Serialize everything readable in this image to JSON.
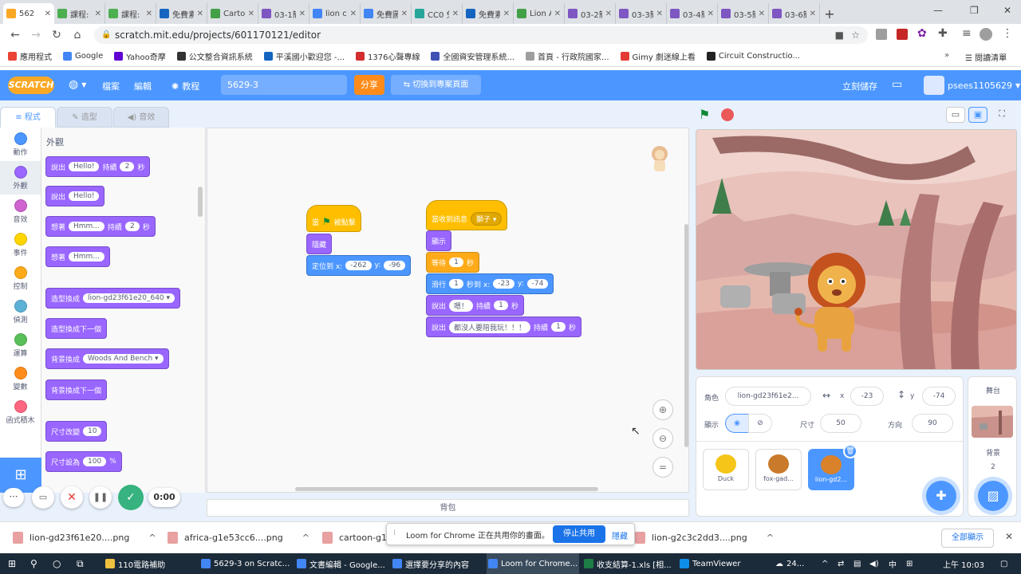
{
  "browser": {
    "tabs": [
      {
        "label": "562",
        "color": "#f9a825",
        "active": true
      },
      {
        "label": "課程:",
        "color": "#4caf50"
      },
      {
        "label": "課程:",
        "color": "#4caf50"
      },
      {
        "label": "免費素",
        "color": "#1565c0"
      },
      {
        "label": "Carto",
        "color": "#43a047"
      },
      {
        "label": "03-1簡",
        "color": "#7e57c2"
      },
      {
        "label": "lion ca",
        "color": "#4285f4"
      },
      {
        "label": "免費圖",
        "color": "#4285f4"
      },
      {
        "label": "CC0 免",
        "color": "#26a69a"
      },
      {
        "label": "免費素",
        "color": "#1565c0"
      },
      {
        "label": "Lion A",
        "color": "#43a047"
      },
      {
        "label": "03-2簡",
        "color": "#7e57c2"
      },
      {
        "label": "03-3簡",
        "color": "#7e57c2"
      },
      {
        "label": "03-4簡",
        "color": "#7e57c2"
      },
      {
        "label": "03-5簡",
        "color": "#7e57c2"
      },
      {
        "label": "03-6簡",
        "color": "#7e57c2"
      }
    ],
    "url": "scratch.mit.edu/projects/601170121/editor",
    "bookmarks": [
      {
        "label": "應用程式",
        "color": "#ea4335"
      },
      {
        "label": "Google",
        "color": "#4285f4"
      },
      {
        "label": "Yahoo奇摩",
        "color": "#6001d2"
      },
      {
        "label": "公文整合資訊系統",
        "color": "#333333"
      },
      {
        "label": "平溪國小歡迎您 -...",
        "color": "#1565c0"
      },
      {
        "label": "1376心聲專線",
        "color": "#d32f2f"
      },
      {
        "label": "全國資安管理系統...",
        "color": "#3f51b5"
      },
      {
        "label": "首頁 - 行政院國家...",
        "color": "#9e9e9e"
      },
      {
        "label": "Gimy 劇迷線上看",
        "color": "#e53935"
      },
      {
        "label": "Circuit Constructio...",
        "color": "#222222"
      }
    ],
    "reading_list": "閱讀清單"
  },
  "scratch": {
    "logo": "SCRATCH",
    "menu_file": "檔案",
    "menu_edit": "編輯",
    "tutorials": "教程",
    "project_title": "5629-3",
    "share": "分享",
    "see_project": "切換到專案頁面",
    "save_now": "立刻儲存",
    "username": "psees1105629",
    "tab_code": "程式",
    "tab_costumes": "造型",
    "tab_sounds": "音效",
    "categories": [
      {
        "label": "動作",
        "color": "#4c97ff"
      },
      {
        "label": "外觀",
        "color": "#9966ff",
        "active": true
      },
      {
        "label": "音效",
        "color": "#cf63cf"
      },
      {
        "label": "事件",
        "color": "#ffd500"
      },
      {
        "label": "控制",
        "color": "#ffab19"
      },
      {
        "label": "偵測",
        "color": "#5cb1d6"
      },
      {
        "label": "運算",
        "color": "#59c059"
      },
      {
        "label": "變數",
        "color": "#ff8c1a"
      },
      {
        "label": "函式積木",
        "color": "#ff6680"
      }
    ],
    "palette_title": "外觀",
    "palette": {
      "say_for": {
        "a": "說出",
        "v1": "Hello!",
        "b": "持續",
        "v2": "2",
        "c": "秒"
      },
      "say": {
        "a": "說出",
        "v1": "Hello!"
      },
      "think_for": {
        "a": "想著",
        "v1": "Hmm...",
        "b": "持續",
        "v2": "2",
        "c": "秒"
      },
      "think": {
        "a": "想著",
        "v1": "Hmm..."
      },
      "switch_costume": {
        "a": "造型換成",
        "v1": "lion-gd23f61e20_640"
      },
      "next_costume": "造型換成下一個",
      "switch_backdrop": {
        "a": "背景換成",
        "v1": "Woods And Bench"
      },
      "next_backdrop": "背景換成下一個",
      "change_size": {
        "a": "尺寸改變",
        "v1": "10"
      },
      "set_size": {
        "a": "尺寸設為",
        "v1": "100",
        "b": "%"
      }
    },
    "script1": {
      "hat_a": "當",
      "hat_b": "被點擊",
      "hide": "隱藏",
      "goto": {
        "a": "定位到 x:",
        "x": "-262",
        "b": "y:",
        "y": "-96"
      }
    },
    "script2": {
      "hat_a": "當收到訊息",
      "hat_v": "獅子",
      "show": "顯示",
      "wait": {
        "a": "等待",
        "v": "1",
        "b": "秒"
      },
      "glide": {
        "a": "滑行",
        "v": "1",
        "b": "秒到 x:",
        "x": "-23",
        "c": "y:",
        "y": "-74"
      },
      "say1": {
        "a": "說出",
        "v": "嗯！",
        "b": "持續",
        "t": "1",
        "c": "秒"
      },
      "say2": {
        "a": "說出",
        "v": "都沒人要陪我玩！！！",
        "b": "持續",
        "t": "1",
        "c": "秒"
      }
    },
    "backpack": "背包",
    "sprite_info": {
      "sprite_label": "角色",
      "sprite_name": "lion-gd23f61e2...",
      "x_label": "x",
      "x": "-23",
      "y_label": "y",
      "y": "-74",
      "show_label": "顯示",
      "size_label": "尺寸",
      "size": "50",
      "direction_label": "方向",
      "direction": "90"
    },
    "sprites": [
      {
        "name": "Duck"
      },
      {
        "name": "fox-gad..."
      },
      {
        "name": "lion-gd2...",
        "selected": true
      }
    ],
    "stage_label": "舞台",
    "backdrops_label": "背景",
    "backdrops_count": "2"
  },
  "recorder": {
    "timer": "0:00"
  },
  "downloads": [
    {
      "name": "lion-gd23f61e20....png"
    },
    {
      "name": "africa-g1e53cc6....png"
    },
    {
      "name": "cartoon-g1"
    },
    {
      "name": "lion-g2c3c2dd3....png"
    }
  ],
  "downloads_show_all": "全部顯示",
  "loom": {
    "message": "Loom for Chrome 正在共用你的畫面。",
    "stop": "停止共用",
    "hide": "隱藏"
  },
  "taskbar": {
    "items": [
      {
        "label": "110電路補助",
        "color": "#f0c040"
      },
      {
        "label": "5629-3 on Scratc...",
        "color": "#4285f4"
      },
      {
        "label": "文書編輯 - Google...",
        "color": "#4285f4"
      },
      {
        "label": "選擇要分享的內容",
        "color": "#4285f4"
      },
      {
        "label": "Loom for Chrome...",
        "color": "#4285f4"
      },
      {
        "label": "收支結算-1.xls [相...",
        "color": "#1e7e45"
      },
      {
        "label": "TeamViewer",
        "color": "#0e8ee9"
      }
    ],
    "temp": "24...",
    "ime": "中",
    "clock": "上午 10:03"
  }
}
